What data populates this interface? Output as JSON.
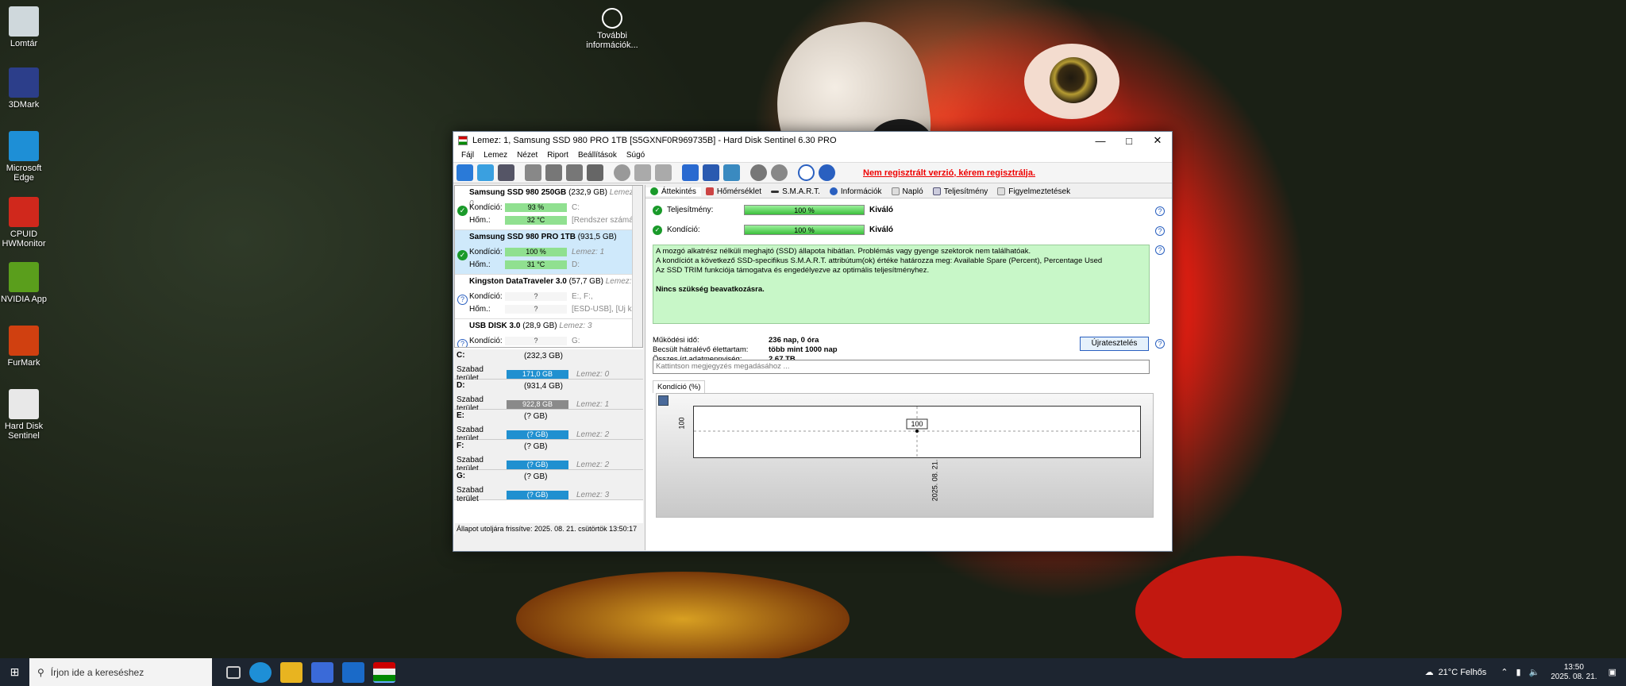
{
  "desktop": {
    "icons": [
      {
        "label": "Lomtár",
        "color": "#cfd8dc"
      },
      {
        "label": "3DMark",
        "color": "#2c3e8a"
      },
      {
        "label": "Microsoft Edge",
        "color": "#1e8fd6"
      },
      {
        "label": "CPUID HWMonitor",
        "color": "#d0281c"
      },
      {
        "label": "NVIDIA App",
        "color": "#5a9e1c"
      },
      {
        "label": "FurMark",
        "color": "#d04010"
      },
      {
        "label": "Hard Disk Sentinel",
        "color": "#e8e8e8"
      }
    ],
    "info_icon": "További információk..."
  },
  "window": {
    "title": "Lemez: 1, Samsung SSD 980 PRO 1TB [S5GXNF0R969735B]  -  Hard Disk Sentinel 6.30 PRO",
    "menu": [
      "Fájl",
      "Lemez",
      "Nézet",
      "Riport",
      "Beállítások",
      "Súgó"
    ],
    "register_warning": "Nem regisztrált verzió, kérem regisztrálja.",
    "disks": [
      {
        "name": "Samsung SSD 980 250GB",
        "cap": "(232,9 GB)",
        "disk": "Lemez: 0",
        "kond_label": "Kondíció:",
        "kond": "93 %",
        "hom_label": "Hőm.:",
        "hom": "32 °C",
        "side1": "C:",
        "side2": "[Rendszer számá"
      },
      {
        "name": "Samsung SSD 980 PRO 1TB",
        "cap": "(931,5 GB)",
        "disk": "Lemez: 1",
        "kond_label": "Kondíció:",
        "kond": "100 %",
        "hom_label": "Hőm.:",
        "hom": "31 °C",
        "side1": "Lemez: 1",
        "side2": "D:"
      },
      {
        "name": "Kingston DataTraveler 3.0",
        "cap": "(57,7 GB)",
        "disk": "Lemez: 2",
        "kond_label": "Kondíció:",
        "kond": "?",
        "hom_label": "Hőm.:",
        "hom": "?",
        "side1": "E:, F:,",
        "side2": "[ESD-USB], [Új k"
      },
      {
        "name": "USB DISK 3.0",
        "cap": "(28,9 GB)",
        "disk": "Lemez: 3",
        "kond_label": "Kondíció:",
        "kond": "?",
        "side1": "G:"
      }
    ],
    "volumes": [
      {
        "letter": "C:",
        "cap": "(232,3 GB)",
        "free_label": "Szabad terület",
        "free": "171,0 GB",
        "disk": "Lemez: 0",
        "color": "#2090d0"
      },
      {
        "letter": "D:",
        "cap": "(931,4 GB)",
        "free_label": "Szabad terület",
        "free": "922,8 GB",
        "disk": "Lemez: 1",
        "color": "#8a8a8a"
      },
      {
        "letter": "E:",
        "cap": "(? GB)",
        "free_label": "Szabad terület",
        "free": "(? GB)",
        "disk": "Lemez: 2",
        "color": "#2090d0"
      },
      {
        "letter": "F:",
        "cap": "(? GB)",
        "free_label": "Szabad terület",
        "free": "(? GB)",
        "disk": "Lemez: 2",
        "color": "#2090d0"
      },
      {
        "letter": "G:",
        "cap": "(? GB)",
        "free_label": "Szabad terület",
        "free": "(? GB)",
        "disk": "Lemez: 3",
        "color": "#2090d0"
      }
    ],
    "status": "Állapot utoljára frissítve: 2025. 08. 21. csütörtök 13:50:17",
    "tabs": [
      "Áttekintés",
      "Hőmérséklet",
      "S.M.A.R.T.",
      "Információk",
      "Napló",
      "Teljesítmény",
      "Figyelmeztetések"
    ],
    "perf": {
      "label": "Teljesítmény:",
      "value": "100 %",
      "pct": 100,
      "rating": "Kiváló"
    },
    "cond": {
      "label": "Kondíció:",
      "value": "100 %",
      "pct": 100,
      "rating": "Kiváló"
    },
    "desc": [
      "A mozgó alkatrész nélküli meghajtó (SSD) állapota hibátlan. Problémás vagy gyenge szektorok nem találhatóak.",
      "A kondíciót a következő SSD-specifikus S.M.A.R.T. attribútum(ok) értéke határozza meg:  Available Spare (Percent), Percentage Used",
      "Az SSD TRIM funkciója támogatva és engedélyezve az optimális teljesítményhez."
    ],
    "desc_bold": "Nincs szükség beavatkozásra.",
    "info": [
      {
        "k": "Működési idő:",
        "v": "236 nap, 0 óra"
      },
      {
        "k": "Becsült hátralévő élettartam:",
        "v": "több mint 1000 nap"
      },
      {
        "k": "Összes írt adatmennyiség:",
        "v": "2,67 TB"
      }
    ],
    "retest": "Újratesztelés",
    "note_placeholder": "Kattintson megjegyzés megadásához ...",
    "subtab": "Kondíció  (%)"
  },
  "chart_data": {
    "type": "line",
    "x": [
      "2025. 08. 21."
    ],
    "series": [
      {
        "values": [
          100
        ]
      }
    ],
    "ylabel": "100",
    "data_label": "100"
  },
  "taskbar": {
    "search": "Írjon ide a kereséshez",
    "weather": "21°C  Felhős",
    "time": "13:50",
    "date": "2025. 08. 21."
  }
}
